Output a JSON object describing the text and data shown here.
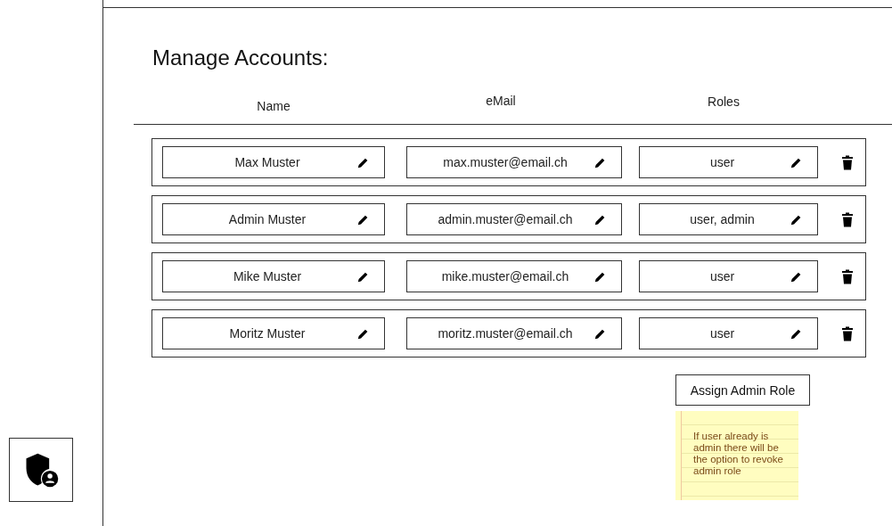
{
  "title": "Manage Accounts:",
  "columns": [
    "Name",
    "eMail",
    "Roles"
  ],
  "accounts": [
    {
      "name": "Max Muster",
      "email": "max.muster@email.ch",
      "roles": "user"
    },
    {
      "name": "Admin Muster",
      "email": "admin.muster@email.ch",
      "roles": "user, admin"
    },
    {
      "name": "Mike Muster",
      "email": "mike.muster@email.ch",
      "roles": "user"
    },
    {
      "name": "Moritz Muster",
      "email": "moritz.muster@email.ch",
      "roles": "user"
    }
  ],
  "role_menu": {
    "label": "Assign Admin Role"
  },
  "sticky_note": "If user already is admin there will be the option to revoke admin role"
}
